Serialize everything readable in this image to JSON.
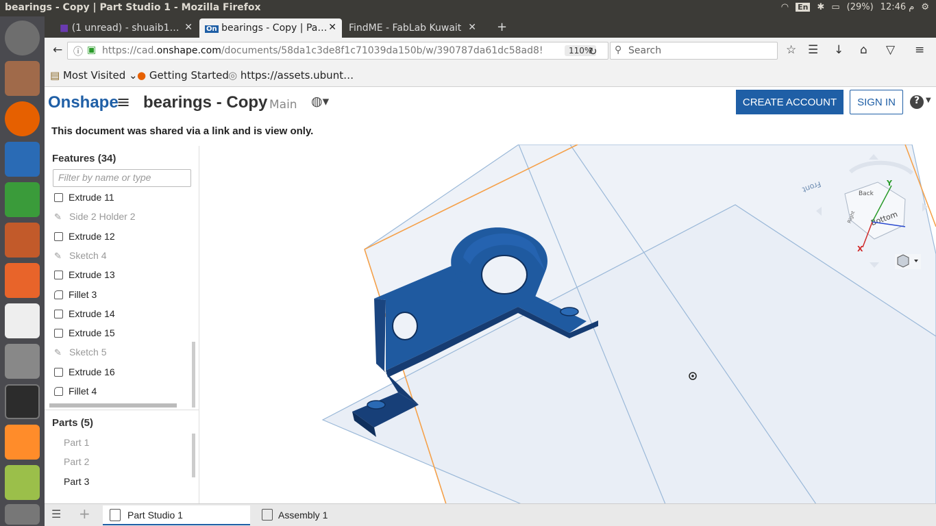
{
  "system": {
    "window_title": "bearings - Copy | Part Studio 1 - Mozilla Firefox",
    "keyboard": "En",
    "battery": "(29%)",
    "time": "12:46 م"
  },
  "browser": {
    "tabs": [
      {
        "label": "(1 unread) - shuaib1…"
      },
      {
        "label": "bearings - Copy | Pa…"
      },
      {
        "label": "FindME - FabLab Kuwait"
      }
    ],
    "url_prefix": "https://cad.",
    "url_domain": "onshape.com",
    "url_rest": "/documents/58da1c3de8f1c71039da150b/w/390787da61dc58ad8!",
    "zoom": "110%",
    "search_placeholder": "Search",
    "bookmarks": [
      "Most Visited",
      "Getting Started",
      "https://assets.ubunt…"
    ]
  },
  "app": {
    "logo": "Onshape",
    "doc_name": "bearings - Copy",
    "workspace": "Main",
    "create_account": "CREATE ACCOUNT",
    "sign_in": "SIGN IN",
    "notice": "This document was shared via a link and is view only.",
    "features_title": "Features (34)",
    "filter_placeholder": "Filter by name or type",
    "features": [
      {
        "label": "Extrude 11",
        "kind": "extrude"
      },
      {
        "label": "Side 2 Holder 2",
        "kind": "sketch"
      },
      {
        "label": "Extrude 12",
        "kind": "extrude"
      },
      {
        "label": "Sketch 4",
        "kind": "sketch"
      },
      {
        "label": "Extrude 13",
        "kind": "extrude"
      },
      {
        "label": "Fillet 3",
        "kind": "fillet"
      },
      {
        "label": "Extrude 14",
        "kind": "extrude"
      },
      {
        "label": "Extrude 15",
        "kind": "extrude"
      },
      {
        "label": "Sketch 5",
        "kind": "sketch"
      },
      {
        "label": "Extrude 16",
        "kind": "extrude"
      },
      {
        "label": "Fillet 4",
        "kind": "fillet"
      }
    ],
    "parts_title": "Parts (5)",
    "parts": [
      "Part 1",
      "Part 2",
      "Part 3"
    ],
    "viewcube": {
      "back": "Back",
      "bottom": "Bottom",
      "right": "Right",
      "front": "Front",
      "axis_x": "X",
      "axis_y": "Y"
    },
    "bottom_tabs": [
      "Part Studio 1",
      "Assembly 1"
    ],
    "colors": {
      "brand": "#1f5fa6",
      "part": "#1f5aa0",
      "plane": "#f5a14a"
    }
  }
}
